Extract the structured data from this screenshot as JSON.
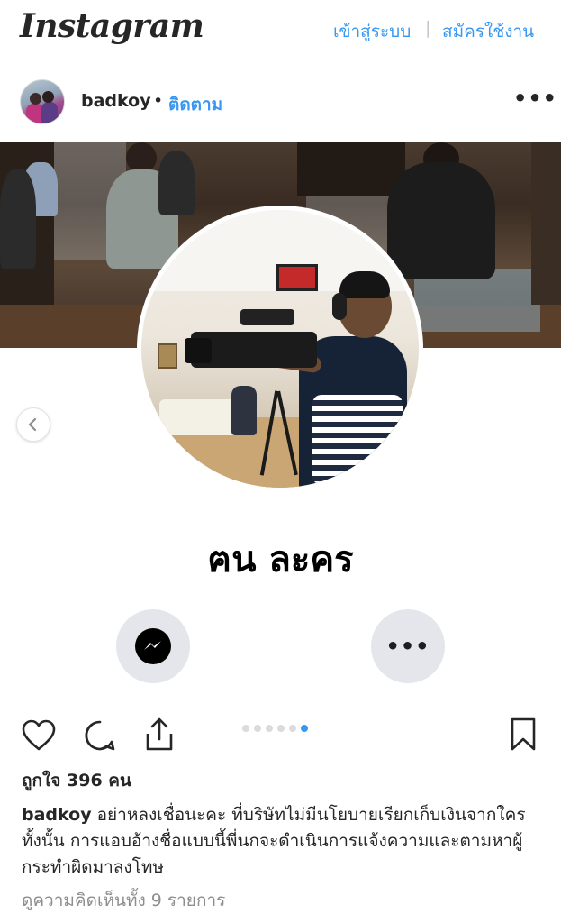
{
  "topnav": {
    "logo": "Instagram",
    "login_label": "เข้าสู่ระบบ",
    "separator": "|",
    "signup_label": "สมัครใช้งาน",
    "accent_color": "#3897f0"
  },
  "post": {
    "username": "badkoy",
    "dot": "•",
    "follow_label": "ติดตาม",
    "more_icon": "more-horizontal-icon",
    "profile_name": "ฅน ละคร",
    "carousel": {
      "slide_count": 6,
      "active_index": 5
    },
    "likes_text": "ถูกใจ 396 คน",
    "caption_user": "badkoy",
    "caption_text": "อย่าหลงเชื่อนะคะ ที่บริษัทไม่มีนโยบายเรียกเก็บเงินจากใครทั้งนั้น การแอบอ้างชื่อแบบนี้พี่นกจะดำเนินการแจ้งความและตามหาผู้กระทำผิดมาลงโทษ",
    "view_comments": "ดูความคิดเห็นทั้ง 9 รายการ"
  },
  "icons": {
    "like": "heart-icon",
    "comment": "comment-icon",
    "share": "share-icon",
    "save": "bookmark-icon",
    "prev": "chevron-left-icon",
    "messenger": "messenger-icon"
  }
}
